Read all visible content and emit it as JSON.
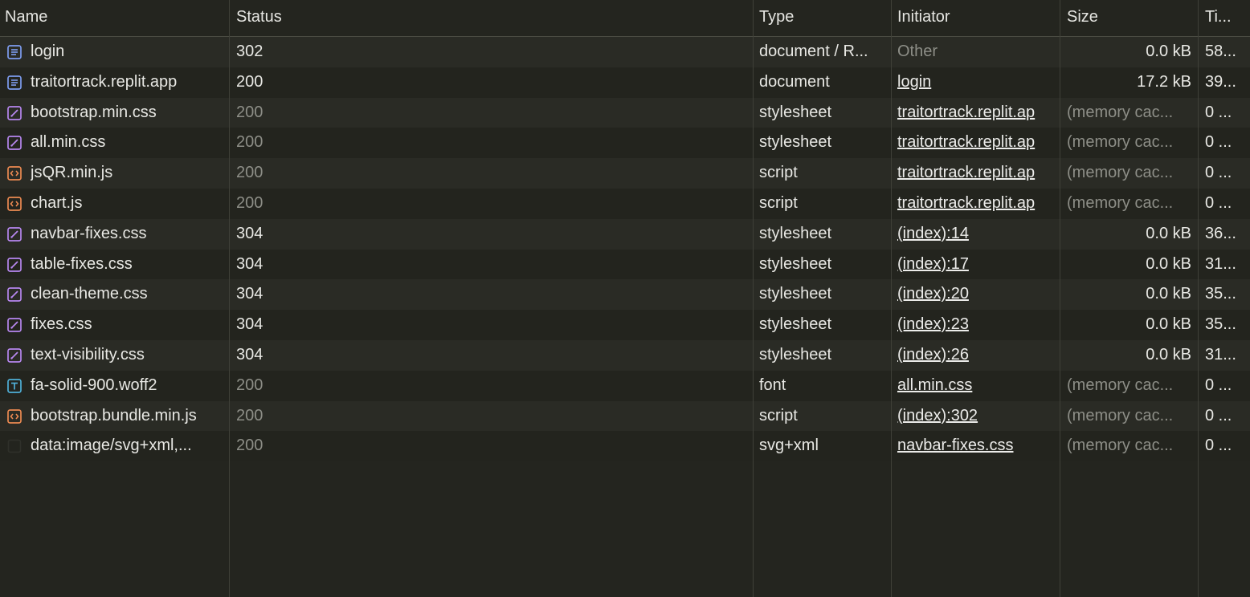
{
  "columns": {
    "name": "Name",
    "status": "Status",
    "type": "Type",
    "initiator": "Initiator",
    "size": "Size",
    "time": "Ti..."
  },
  "colors": {
    "doc_icon": "#7e9df0",
    "css_icon": "#b787f0",
    "script_icon": "#ec8a52",
    "font_icon": "#4fb0d8",
    "dim_text": "#8d8e87"
  },
  "rows": [
    {
      "icon": "document-icon",
      "name": "login",
      "status": "302",
      "status_dim": false,
      "type": "document / R...",
      "initiator": "Other",
      "initiator_link": false,
      "size": "0.0 kB",
      "size_dim": false,
      "time": "58..."
    },
    {
      "icon": "document-icon",
      "name": "traitortrack.replit.app",
      "status": "200",
      "status_dim": false,
      "type": "document",
      "initiator": "login",
      "initiator_link": true,
      "size": "17.2 kB",
      "size_dim": false,
      "time": "39..."
    },
    {
      "icon": "stylesheet-icon",
      "name": "bootstrap.min.css",
      "status": "200",
      "status_dim": true,
      "type": "stylesheet",
      "initiator": "traitortrack.replit.ap",
      "initiator_link": true,
      "size": "(memory cac...",
      "size_dim": true,
      "time": "0 ..."
    },
    {
      "icon": "stylesheet-icon",
      "name": "all.min.css",
      "status": "200",
      "status_dim": true,
      "type": "stylesheet",
      "initiator": "traitortrack.replit.ap",
      "initiator_link": true,
      "size": "(memory cac...",
      "size_dim": true,
      "time": "0 ..."
    },
    {
      "icon": "script-icon",
      "name": "jsQR.min.js",
      "status": "200",
      "status_dim": true,
      "type": "script",
      "initiator": "traitortrack.replit.ap",
      "initiator_link": true,
      "size": "(memory cac...",
      "size_dim": true,
      "time": "0 ..."
    },
    {
      "icon": "script-icon",
      "name": "chart.js",
      "status": "200",
      "status_dim": true,
      "type": "script",
      "initiator": "traitortrack.replit.ap",
      "initiator_link": true,
      "size": "(memory cac...",
      "size_dim": true,
      "time": "0 ..."
    },
    {
      "icon": "stylesheet-icon",
      "name": "navbar-fixes.css",
      "status": "304",
      "status_dim": false,
      "type": "stylesheet",
      "initiator": "(index):14",
      "initiator_link": true,
      "size": "0.0 kB",
      "size_dim": false,
      "time": "36..."
    },
    {
      "icon": "stylesheet-icon",
      "name": "table-fixes.css",
      "status": "304",
      "status_dim": false,
      "type": "stylesheet",
      "initiator": "(index):17",
      "initiator_link": true,
      "size": "0.0 kB",
      "size_dim": false,
      "time": "31..."
    },
    {
      "icon": "stylesheet-icon",
      "name": "clean-theme.css",
      "status": "304",
      "status_dim": false,
      "type": "stylesheet",
      "initiator": "(index):20",
      "initiator_link": true,
      "size": "0.0 kB",
      "size_dim": false,
      "time": "35..."
    },
    {
      "icon": "stylesheet-icon",
      "name": "fixes.css",
      "status": "304",
      "status_dim": false,
      "type": "stylesheet",
      "initiator": "(index):23",
      "initiator_link": true,
      "size": "0.0 kB",
      "size_dim": false,
      "time": "35..."
    },
    {
      "icon": "stylesheet-icon",
      "name": "text-visibility.css",
      "status": "304",
      "status_dim": false,
      "type": "stylesheet",
      "initiator": "(index):26",
      "initiator_link": true,
      "size": "0.0 kB",
      "size_dim": false,
      "time": "31..."
    },
    {
      "icon": "font-icon",
      "name": "fa-solid-900.woff2",
      "status": "200",
      "status_dim": true,
      "type": "font",
      "initiator": "all.min.css",
      "initiator_link": true,
      "size": "(memory cac...",
      "size_dim": true,
      "time": "0 ..."
    },
    {
      "icon": "script-icon",
      "name": "bootstrap.bundle.min.js",
      "status": "200",
      "status_dim": true,
      "type": "script",
      "initiator": "(index):302",
      "initiator_link": true,
      "size": "(memory cac...",
      "size_dim": true,
      "time": "0 ..."
    },
    {
      "icon": "image-icon",
      "name": "data:image/svg+xml,...",
      "status": "200",
      "status_dim": true,
      "type": "svg+xml",
      "initiator": "navbar-fixes.css",
      "initiator_link": true,
      "size": "(memory cac...",
      "size_dim": true,
      "time": "0 ..."
    }
  ]
}
